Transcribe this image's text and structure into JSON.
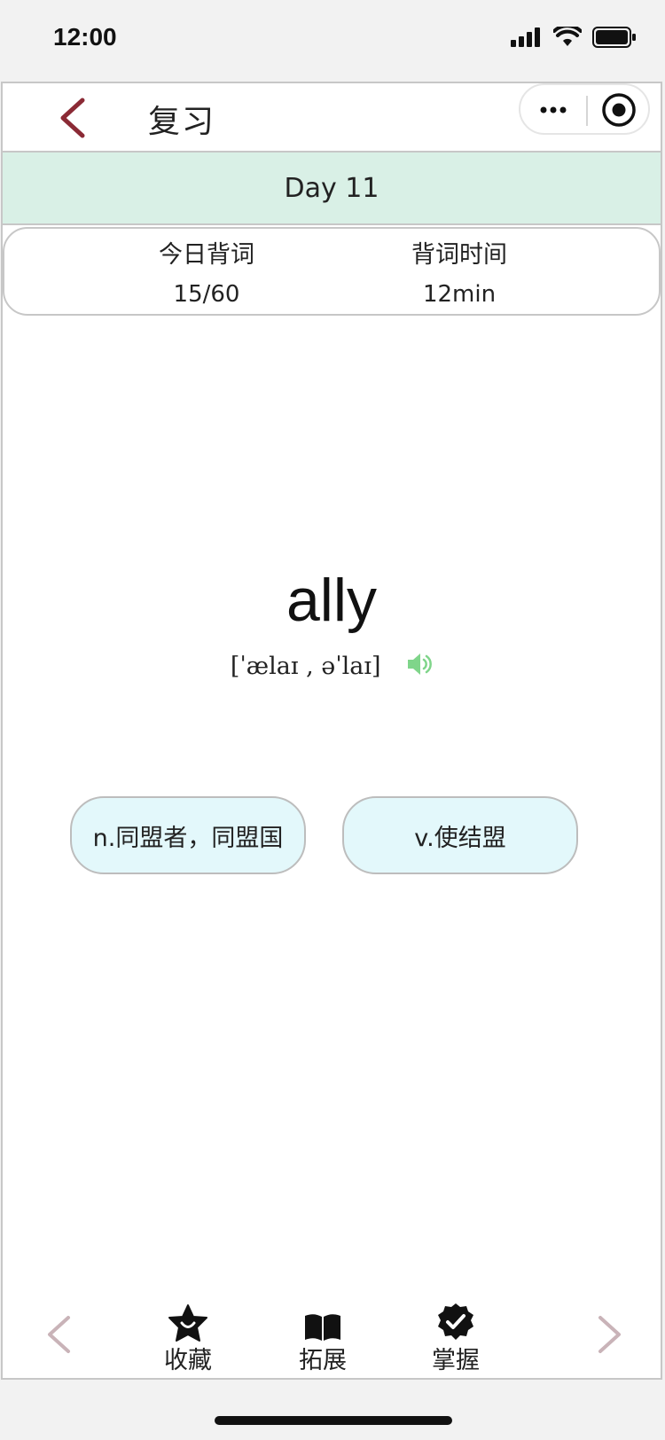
{
  "status_bar": {
    "time": "12:00"
  },
  "nav": {
    "title": "复习",
    "back_icon": "chevron-left-icon",
    "more_icon": "more-icon",
    "close_icon": "target-close-icon"
  },
  "day_banner": {
    "label": "Day 11"
  },
  "stats": {
    "today_words_label": "今日背词",
    "today_words_value": "15/60",
    "study_time_label": "背词时间",
    "study_time_value": "12min"
  },
  "word": {
    "text": "ally",
    "phonetic": "[ˈælaɪ , əˈlaɪ]",
    "speaker_icon": "speaker-icon"
  },
  "meanings": [
    {
      "label": "n.同盟者，同盟国"
    },
    {
      "label": "v.使结盟"
    }
  ],
  "toolbar": {
    "prev_icon": "chevron-left-icon",
    "next_icon": "chevron-right-icon",
    "items": [
      {
        "label": "收藏",
        "icon": "star-icon"
      },
      {
        "label": "拓展",
        "icon": "book-icon"
      },
      {
        "label": "掌握",
        "icon": "verified-badge-icon"
      }
    ]
  },
  "colors": {
    "accent_back": "#8b2a35",
    "banner_bg": "#d9f0e6",
    "meaning_bg": "#e3f8fb",
    "speaker": "#7fd58a",
    "arrow_muted": "#c9b3b8"
  }
}
